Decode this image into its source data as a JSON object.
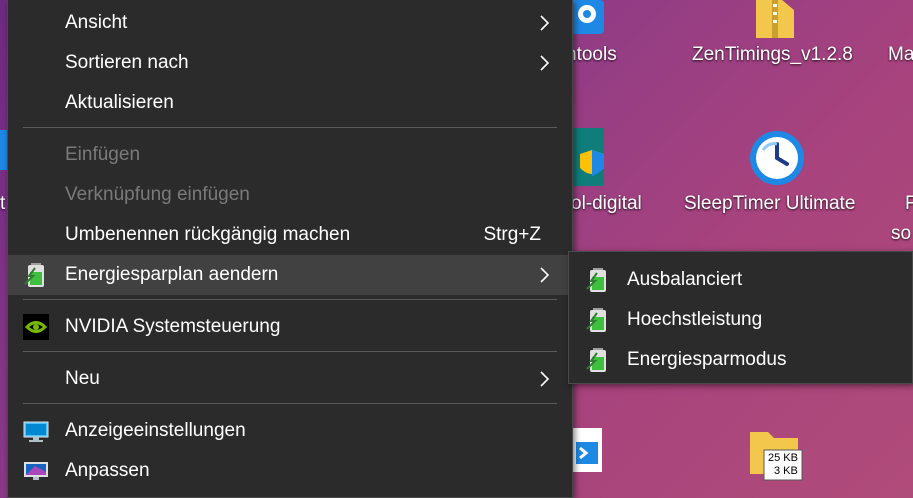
{
  "desktop": {
    "icons": [
      {
        "name": "devtools",
        "label": "ntools"
      },
      {
        "name": "zentimings",
        "label": "ZenTimings_v1.2.8"
      },
      {
        "name": "edge-partial",
        "label": "Ma"
      },
      {
        "name": "tool-digital",
        "label": "ol-digital"
      },
      {
        "name": "sleeptimer",
        "label": "SleepTimer Ultimate"
      },
      {
        "name": "partial-right-1",
        "label": "F"
      },
      {
        "name": "partial-right-2",
        "label": "so"
      },
      {
        "name": "partial-left",
        "label": "t"
      },
      {
        "name": "folder-size-shortcut",
        "label": ""
      }
    ],
    "foldersize_badge": {
      "line1": "25 KB",
      "line2": "3 KB"
    }
  },
  "context_menu": {
    "items": [
      {
        "label": "Ansicht",
        "submenu": true
      },
      {
        "label": "Sortieren nach",
        "submenu": true
      },
      {
        "label": "Aktualisieren"
      },
      {
        "label": "Einfügen",
        "disabled": true
      },
      {
        "label": "Verknüpfung einfügen",
        "disabled": true
      },
      {
        "label": "Umbenennen rückgängig machen",
        "shortcut": "Strg+Z"
      },
      {
        "label": "Energiesparplan aendern",
        "submenu": true,
        "icon": "battery-icon",
        "highlighted": true
      },
      {
        "label": "NVIDIA Systemsteuerung",
        "icon": "nvidia-icon"
      },
      {
        "label": "Neu",
        "submenu": true
      },
      {
        "label": "Anzeigeeinstellungen",
        "icon": "display-settings-icon"
      },
      {
        "label": "Anpassen",
        "icon": "personalize-icon"
      }
    ]
  },
  "submenu": {
    "items": [
      {
        "label": "Ausbalanciert",
        "icon": "battery-icon"
      },
      {
        "label": "Hoechstleistung",
        "icon": "battery-icon"
      },
      {
        "label": "Energiesparmodus",
        "icon": "battery-icon"
      }
    ]
  },
  "colors": {
    "menu_bg": "#2b2b2b",
    "menu_hover": "#414141",
    "menu_text": "#ffffff",
    "menu_disabled": "#7a7a7a",
    "separator": "#5a5a5a",
    "nvidia_green": "#76b900",
    "battery_green": "#3fbf3f"
  }
}
